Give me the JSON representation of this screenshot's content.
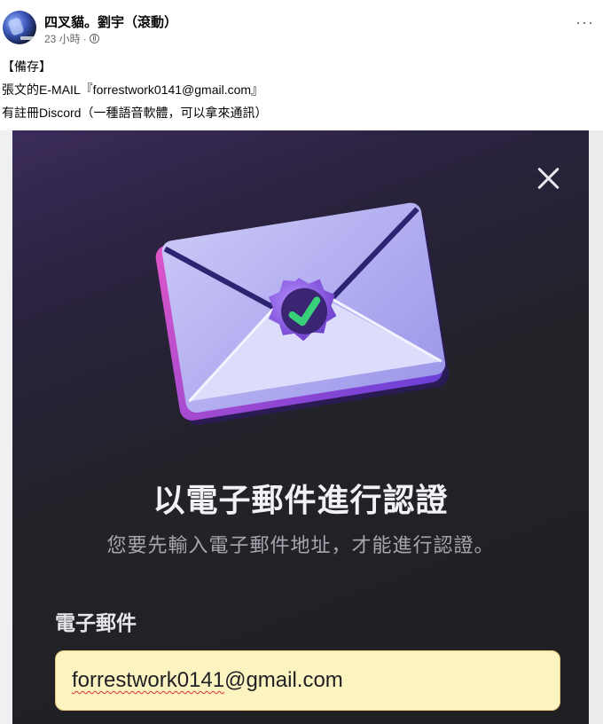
{
  "post": {
    "author": "四叉貓。劉宇（滾動）",
    "time": "23 小時",
    "separator": "·",
    "more_label": "···",
    "lines": [
      "【備存】",
      "張文的E-MAIL『forrestwork0141@gmail.com』",
      "有註冊Discord（一種語音軟體，可以拿來通訊）"
    ]
  },
  "screenshot": {
    "heading": "以電子郵件進行認證",
    "subtitle": "您要先輸入電子郵件地址，才能進行認證。",
    "field_label": "電子郵件",
    "email_value_user": "forrestwork0141",
    "email_value_domain": "@gmail.com",
    "colors": {
      "background": "#222228",
      "accent": "#7b5cd6",
      "input_fill": "#fbf3c0",
      "check_green": "#3bd07a"
    }
  }
}
